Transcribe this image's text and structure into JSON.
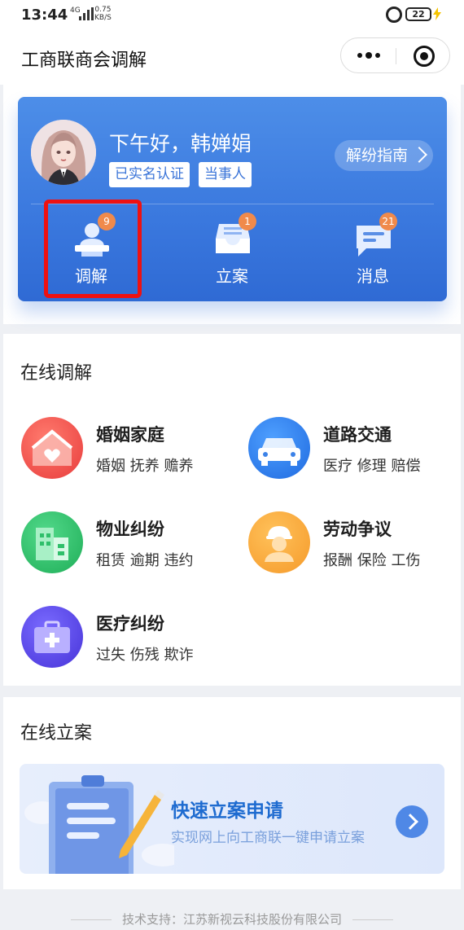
{
  "status_bar": {
    "time": "13:44",
    "network": "4G",
    "speed_value": "0.75",
    "speed_unit": "KB/S",
    "battery": "22"
  },
  "header": {
    "title": "工商联商会调解"
  },
  "profile": {
    "greeting": "下午好，韩婵娟",
    "tags": [
      "已实名认证",
      "当事人"
    ],
    "guide_label": "解纷指南"
  },
  "quick_actions": [
    {
      "label": "调解",
      "badge": "9"
    },
    {
      "label": "立案",
      "badge": "1"
    },
    {
      "label": "消息",
      "badge": "21"
    }
  ],
  "online_mediation": {
    "title": "在线调解",
    "categories": [
      {
        "name": "婚姻家庭",
        "tags": "婚姻 抚养 赡养",
        "color": "#ef4a4a"
      },
      {
        "name": "道路交通",
        "tags": "医疗 修理 赔偿",
        "color": "#2f7fe8"
      },
      {
        "name": "物业纠纷",
        "tags": "租赁 逾期 违约",
        "color": "#2fbf6a"
      },
      {
        "name": "劳动争议",
        "tags": "报酬 保险 工伤",
        "color": "#f7a236"
      },
      {
        "name": "医疗纠纷",
        "tags": "过失 伤残 欺诈",
        "color": "#5b4ee6"
      }
    ]
  },
  "online_filing": {
    "title": "在线立案",
    "banner_title": "快速立案申请",
    "banner_subtitle": "实现网上向工商联一键申请立案"
  },
  "footer": {
    "text": "技术支持：江苏新视云科技股份有限公司"
  }
}
